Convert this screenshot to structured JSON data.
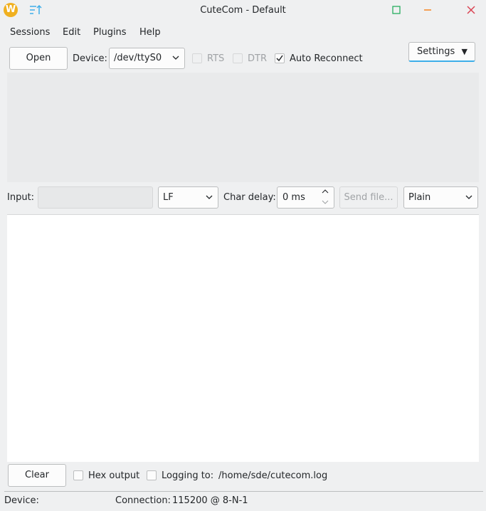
{
  "window": {
    "title": "CuteCom - Default",
    "logo_letter": "W"
  },
  "menubar": {
    "items": [
      "Sessions",
      "Edit",
      "Plugins",
      "Help"
    ]
  },
  "toolbar": {
    "open_label": "Open",
    "device_label": "Device:",
    "device_value": "/dev/ttyS0",
    "rts_label": "RTS",
    "rts_checked": false,
    "dtr_label": "DTR",
    "dtr_checked": false,
    "auto_reconnect_label": "Auto Reconnect",
    "auto_reconnect_checked": true,
    "settings_label": "Settings"
  },
  "input_row": {
    "input_label": "Input:",
    "input_value": "",
    "line_end_value": "LF",
    "char_delay_label": "Char delay:",
    "char_delay_value": "0 ms",
    "send_file_label": "Send file...",
    "format_value": "Plain"
  },
  "bottom_row": {
    "clear_label": "Clear",
    "hex_output_label": "Hex output",
    "hex_output_checked": false,
    "logging_label": "Logging to:",
    "logging_checked": false,
    "log_path": "/home/sde/cutecom.log"
  },
  "statusbar": {
    "device_label": "Device:",
    "connection_label": "Connection:",
    "connection_value": "115200 @ 8-N-1"
  },
  "colors": {
    "window_bg": "#eff0f1",
    "close_icon": "#da4453",
    "maximize_icon": "#27ae60",
    "minimize_icon": "#f67400",
    "accent": "#3daee9",
    "logo": "#f0b020"
  },
  "icons": {
    "logo": "app-logo-icon",
    "menu": "hamburger-sort-icon",
    "maximize": "maximize-icon",
    "minimize": "minimize-icon",
    "close": "close-icon",
    "dropdown": "chevron-down-icon"
  }
}
